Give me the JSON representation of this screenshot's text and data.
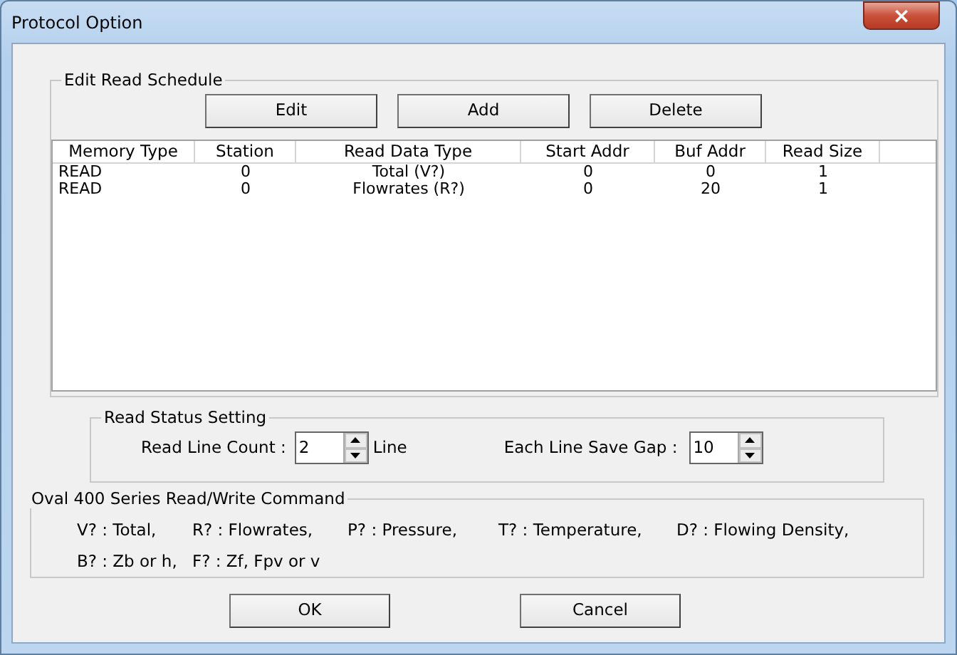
{
  "window": {
    "title": "Protocol Option",
    "close": "×"
  },
  "schedule": {
    "title": "Edit Read Schedule",
    "buttons": [
      "Edit",
      "Add",
      "Delete"
    ],
    "columns": [
      "Memory Type",
      "Station",
      "Read Data Type",
      "Start Addr",
      "Buf Addr",
      "Read Size"
    ],
    "rows": [
      [
        "READ",
        "0",
        "Total (V?)",
        "0",
        "0",
        "1"
      ],
      [
        "READ",
        "0",
        "Flowrates (R?)",
        "0",
        "20",
        "1"
      ]
    ]
  },
  "status": {
    "title": "Read Status Setting",
    "line_count_label": "Read Line Count :",
    "line_count": "2",
    "line_unit": "Line",
    "gap_label": "Each Line Save Gap :",
    "gap": "10"
  },
  "commands": {
    "title": "Oval 400 Series Read/Write Command",
    "rows": [
      [
        "V? : Total,",
        "R? : Flowrates,",
        "P? : Pressure,",
        "T? : Temperature,",
        "D? : Flowing Density,"
      ],
      [
        "B? : Zb or h,",
        "F? : Zf, Fpv or v"
      ]
    ]
  },
  "buttons": [
    "OK",
    "Cancel"
  ]
}
